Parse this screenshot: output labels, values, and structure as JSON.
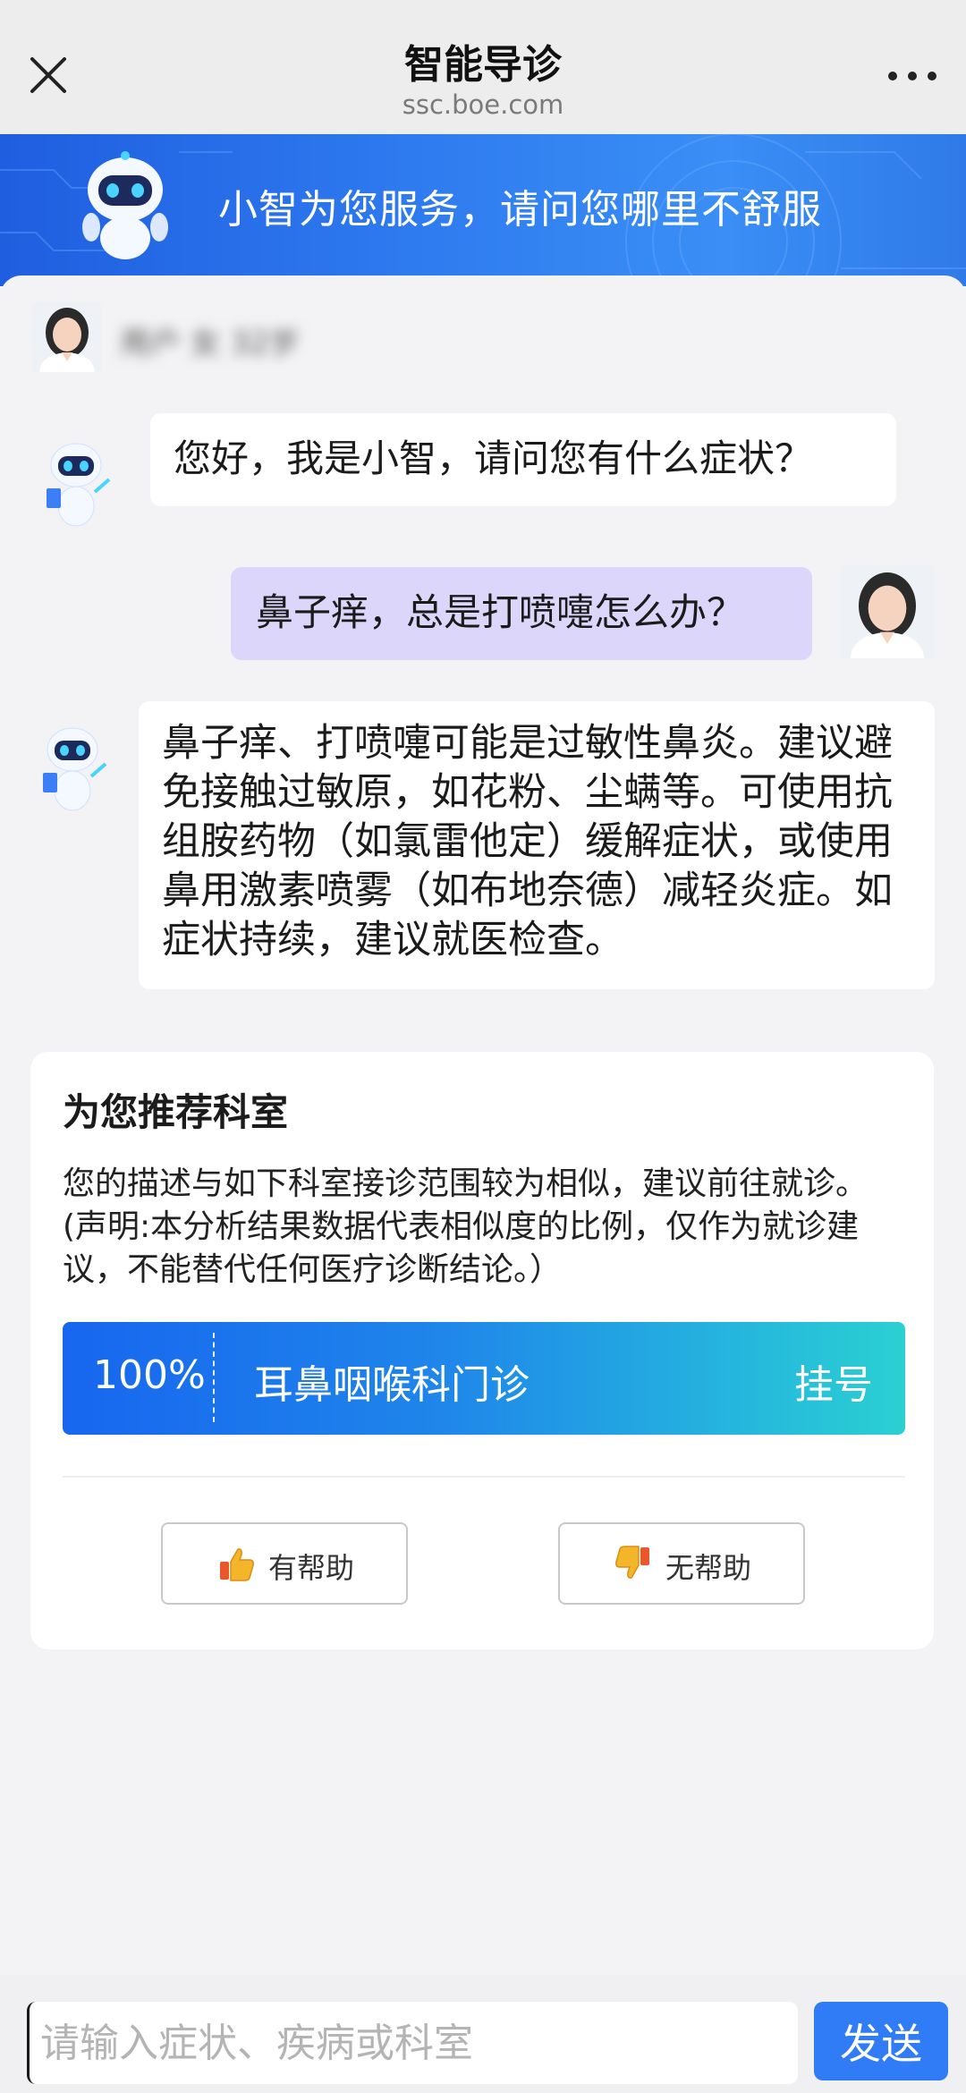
{
  "header": {
    "title": "智能导诊",
    "subtitle": "ssc.boe.com"
  },
  "banner": {
    "text": "小智为您服务，请问您哪里不舒服"
  },
  "user": {
    "name": "用户 女 32岁"
  },
  "chat": {
    "bot_greeting": "您好，我是小智，请问您有什么症状？",
    "user_message": "鼻子痒，总是打喷嚏怎么办？",
    "bot_reply": "鼻子痒、打喷嚏可能是过敏性鼻炎。建议避免接触过敏原，如花粉、尘螨等。可使用抗组胺药物（如氯雷他定）缓解症状，或使用鼻用激素喷雾（如布地奈德）减轻炎症。如症状持续，建议就医检查。"
  },
  "recommend": {
    "heading": "为您推荐科室",
    "description": "您的描述与如下科室接诊范围较为相似，建议前往就诊。(声明:本分析结果数据代表相似度的比例，仅作为就诊建议，不能替代任何医疗诊断结论。）",
    "department": {
      "similarity": "100%",
      "name": "耳鼻咽喉科门诊",
      "action": "挂号"
    },
    "helpful_label": "有帮助",
    "not_helpful_label": "无帮助"
  },
  "input": {
    "placeholder": "请输入症状、疾病或科室",
    "send_label": "发送"
  },
  "colors": {
    "primary": "#2f7cf6",
    "user_bubble": "#dcd6fa",
    "banner": "#2f7cf0"
  }
}
